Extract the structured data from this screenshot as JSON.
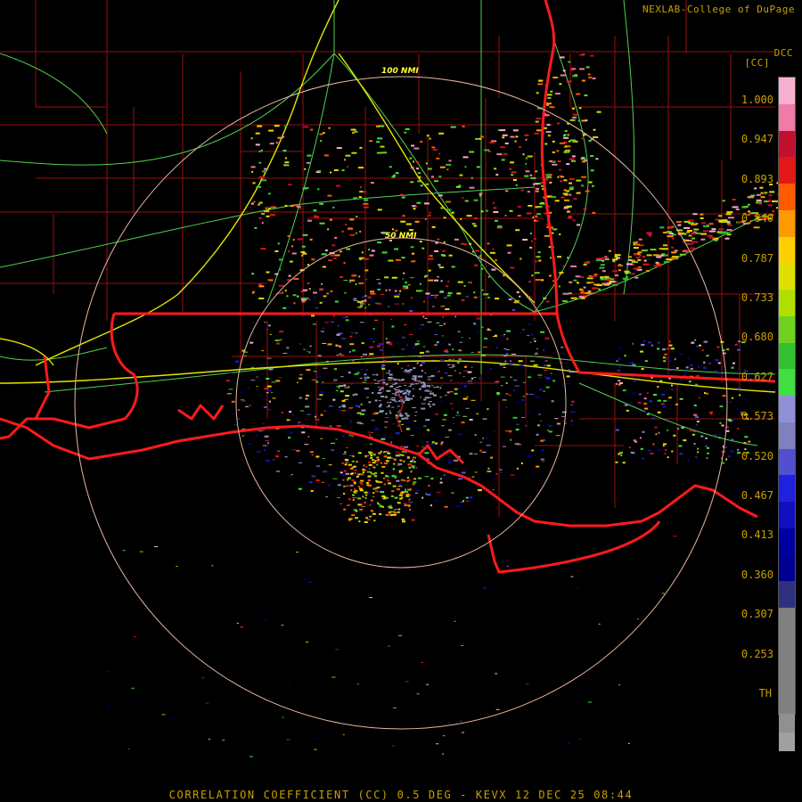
{
  "credit": "NEXLAB-College of DuPage",
  "product_code": "DCC",
  "unit_label": "[CC]",
  "caption": "CORRELATION COEFFICIENT (CC) 0.5 DEG - KEVX 12 DEC 25 08:44",
  "range_rings": [
    {
      "label": "50 NMI"
    },
    {
      "label": "100 NMI"
    }
  ],
  "colors": {
    "state_border": "#ff1a1a",
    "county_border": "#9a1010",
    "highway": "#4fd34f",
    "interstate": "#e6e600",
    "range_ring": "#e8b8a0",
    "text": "#c8a000",
    "background": "#000000"
  },
  "legend": {
    "labels": [
      "1.000",
      "0.947",
      "0.893",
      "0.840",
      "0.787",
      "0.733",
      "0.680",
      "0.627",
      "0.573",
      "0.520",
      "0.467",
      "0.413",
      "0.360",
      "0.307",
      "0.253",
      "TH"
    ],
    "swatches": [
      "#f8b0d0",
      "#f07aa8",
      "#c01030",
      "#e01818",
      "#ff5a00",
      "#ff9a00",
      "#ffd000",
      "#e0e000",
      "#b0e000",
      "#70d020",
      "#30c030",
      "#40e040",
      "#9090d8",
      "#8080c0",
      "#5050d0",
      "#2020e0",
      "#1010c0",
      "#0000a0",
      "#000090",
      "#303080",
      "#808080",
      "#909090",
      "#a0a0a0",
      "#000000"
    ]
  }
}
